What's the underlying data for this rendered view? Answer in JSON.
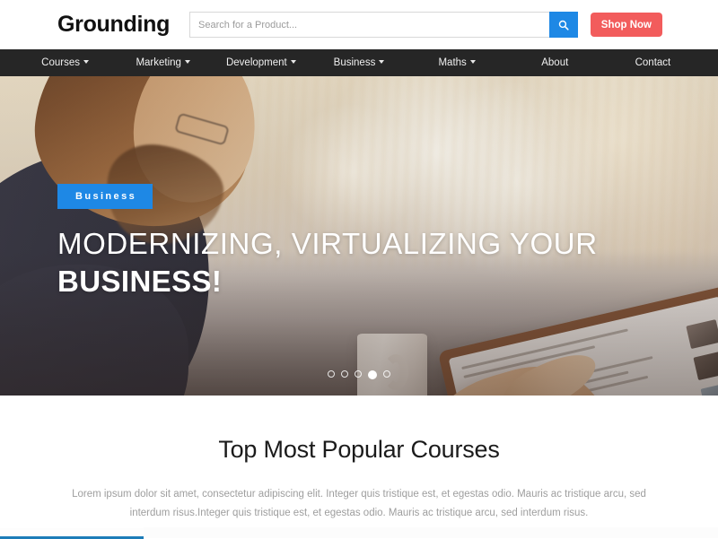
{
  "header": {
    "logo": "Grounding",
    "search": {
      "placeholder": "Search for a Product...",
      "value": "",
      "icon": "search-icon"
    },
    "shop_button": "Shop Now",
    "accent_blue": "#1e88e5",
    "accent_red": "#f25c5c"
  },
  "nav": {
    "background": "#262626",
    "items": [
      {
        "label": "Courses",
        "has_dropdown": true
      },
      {
        "label": "Marketing",
        "has_dropdown": true
      },
      {
        "label": "Development",
        "has_dropdown": true
      },
      {
        "label": "Business",
        "has_dropdown": true
      },
      {
        "label": "Maths",
        "has_dropdown": true
      },
      {
        "label": "About",
        "has_dropdown": false
      },
      {
        "label": "Contact",
        "has_dropdown": false
      }
    ]
  },
  "hero": {
    "badge": "Business",
    "badge_color": "#1e88e5",
    "headline_line1": "MODERNIZING, VIRTUALIZING YOUR",
    "headline_line2": "BUSINESS!",
    "carousel": {
      "total_dots": 5,
      "active_index": 3
    }
  },
  "section": {
    "title": "Top Most Popular Courses",
    "description": "Lorem ipsum dolor sit amet, consectetur adipiscing elit. Integer quis tristique est, et egestas odio. Mauris ac tristique arcu, sed interdum risus.Integer quis tristique est, et egestas odio. Mauris ac tristique arcu, sed interdum risus."
  },
  "tabs": {
    "active_indicator_color": "#1c7cb8"
  }
}
